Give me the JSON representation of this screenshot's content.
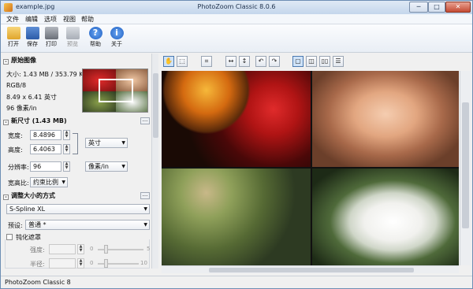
{
  "window": {
    "title": "PhotoZoom Classic 8.0.6",
    "filename": "example.jpg",
    "controls": {
      "minimize": "─",
      "maximize": "□",
      "close": "✕"
    }
  },
  "menu": [
    "文件",
    "编辑",
    "选项",
    "视图",
    "帮助"
  ],
  "toolbar": [
    {
      "label": "打开",
      "icon": "open-folder-icon",
      "color": "#e8b341"
    },
    {
      "label": "保存",
      "icon": "save-disk-icon",
      "color": "#3a6fc0"
    },
    {
      "label": "打印",
      "icon": "printer-icon",
      "color": "#7a7f88"
    },
    {
      "label": "预览",
      "icon": "preview-icon",
      "color": "#9aa2ad"
    },
    {
      "label": "帮助",
      "icon": "help-icon",
      "color": "#2f6fd0"
    },
    {
      "label": "关于",
      "icon": "info-icon",
      "color": "#2f6fd0"
    }
  ],
  "original": {
    "header": "原始图像",
    "size": "大小: 1.43 MB / 353.79 KB",
    "mode": "RGB/8",
    "dims": "8.49 x 6.41 英寸",
    "res": "96 像素/in"
  },
  "newsize": {
    "header": "新尺寸 (1.43 MB)",
    "width_label": "宽度:",
    "width": "8.4896",
    "height_label": "高度:",
    "height": "6.4063",
    "unit": "英寸",
    "res_label": "分辨率:",
    "res": "96",
    "res_unit": "像素/in",
    "ratio_label": "宽高比:",
    "ratio": "约束比例"
  },
  "method": {
    "header": "调整大小的方式",
    "algorithm": "S-Spline XL",
    "preset_label": "预设:",
    "preset": "普通 *",
    "sharpen_label": "钝化遮罩",
    "strength_label": "强度:",
    "strength_min": "0",
    "strength_max": "5",
    "radius_label": "半径:",
    "radius_min": "0",
    "radius_max": "10"
  },
  "status": "PhotoZoom Classic 8",
  "accent": "#4a79b0"
}
